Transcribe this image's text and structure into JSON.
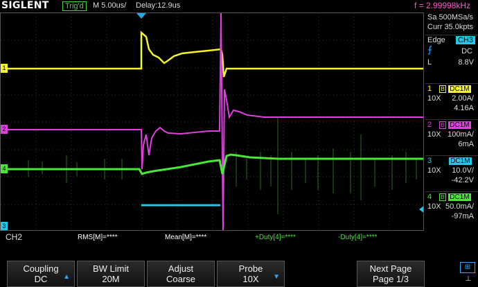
{
  "header": {
    "brand": "SIGLENT",
    "trigger_status": "Trig'd",
    "timebase": "M 5.00us/",
    "delay": "Delay:12.9us",
    "frequency": "f = 2.99998kHz"
  },
  "acquisition": {
    "sample_rate": "Sa 500MSa/s",
    "memory": "Curr 35.0kpts"
  },
  "trigger": {
    "type": "Edge",
    "source": "CH3",
    "coupling": "DC",
    "level_label": "L",
    "level": "8.8V"
  },
  "channels": [
    {
      "num": "1",
      "coupling": "DC1M",
      "probe": "10X",
      "scale": "2.00A/",
      "offset": "4.16A",
      "color": "#f5f528"
    },
    {
      "num": "2",
      "coupling": "DC1M",
      "probe": "10X",
      "scale": "100mA/",
      "offset": "6mA",
      "color": "#e040e0"
    },
    {
      "num": "3",
      "coupling": "DC1M",
      "probe": "10X",
      "scale": "10.0V/",
      "offset": "-42.2V",
      "color": "#23c8e8"
    },
    {
      "num": "4",
      "coupling": "DC1M",
      "probe": "10X",
      "scale": "50.0mA/",
      "offset": "-97mA",
      "color": "#49e73a"
    }
  ],
  "measurements": {
    "rms": "RMS[M]=****",
    "mean": "Mean[M]=****",
    "duty_pos": "+Duty[4]=****",
    "duty_neg": "-Duty[4]=****"
  },
  "menu": {
    "channel": "CH2",
    "coupling_label": "Coupling",
    "coupling_value": "DC",
    "bw_label": "BW Limit",
    "bw_value": "20M",
    "adjust_label": "Adjust",
    "adjust_value": "Coarse",
    "probe_label": "Probe",
    "probe_value": "10X",
    "next_label": "Next Page",
    "next_value": "Page 1/3"
  },
  "icons": [
    "trigger-edge-icon",
    "usb-icon",
    "network-icon"
  ]
}
